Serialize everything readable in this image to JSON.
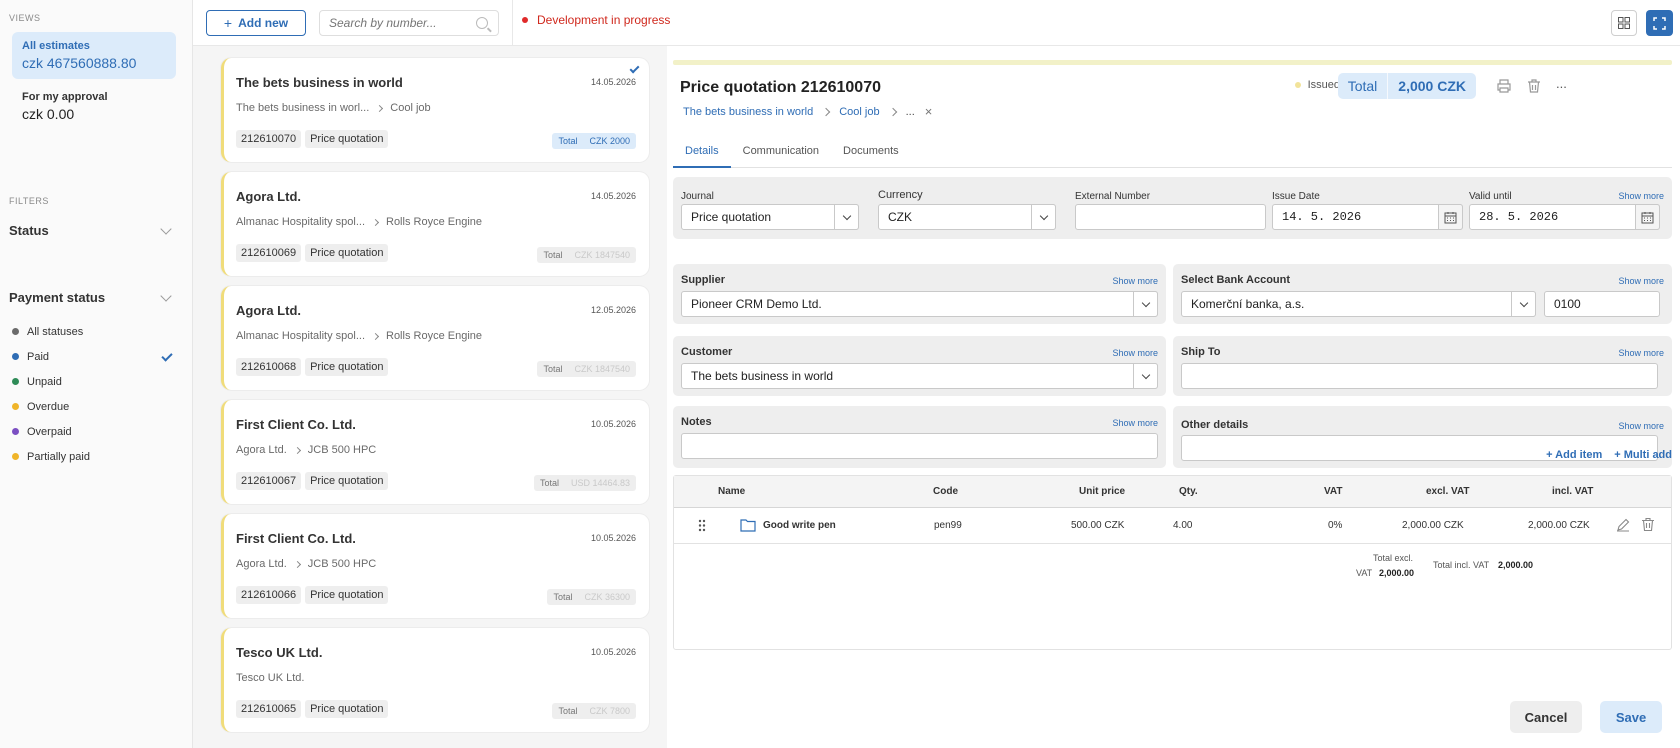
{
  "sidebar": {
    "views_title": "VIEWS",
    "views": [
      {
        "label": "All estimates",
        "amount": "czk 467560888.80"
      },
      {
        "label": "For my approval",
        "amount": "czk 0.00"
      }
    ],
    "filters_title": "FILTERS",
    "status_label": "Status",
    "payment_status_label": "Payment status",
    "statuses": [
      {
        "label": "All statuses",
        "color": "#6b6b6b"
      },
      {
        "label": "Paid",
        "color": "#2f6db5"
      },
      {
        "label": "Unpaid",
        "color": "#2e8b57"
      },
      {
        "label": "Overdue",
        "color": "#f0b429"
      },
      {
        "label": "Overpaid",
        "color": "#7b4fc2"
      },
      {
        "label": "Partially paid",
        "color": "#f0b429"
      }
    ]
  },
  "topbar": {
    "add_new": "Add new",
    "search_placeholder": "Search by number...",
    "dev_note": "Development in progress"
  },
  "cards": [
    {
      "title": "The bets business in world",
      "date": "14.05.2026",
      "path_a": "The bets business in worl...",
      "path_b": "Cool job",
      "number": "212610070",
      "type": "Price quotation",
      "total_label": "Total",
      "total": "CZK 2000"
    },
    {
      "title": "Agora Ltd.",
      "date": "14.05.2026",
      "path_a": "Almanac Hospitality spol...",
      "path_b": "Rolls Royce Engine",
      "number": "212610069",
      "type": "Price quotation",
      "total_label": "Total",
      "total": "CZK 1847540"
    },
    {
      "title": "Agora Ltd.",
      "date": "12.05.2026",
      "path_a": "Almanac Hospitality spol...",
      "path_b": "Rolls Royce Engine",
      "number": "212610068",
      "type": "Price quotation",
      "total_label": "Total",
      "total": "CZK 1847540"
    },
    {
      "title": "First Client Co. Ltd.",
      "date": "10.05.2026",
      "path_a": "Agora Ltd.",
      "path_b": "JCB 500 HPC",
      "number": "212610067",
      "type": "Price quotation",
      "total_label": "Total",
      "total": "USD 14464.83"
    },
    {
      "title": "First Client Co. Ltd.",
      "date": "10.05.2026",
      "path_a": "Agora Ltd.",
      "path_b": "JCB 500 HPC",
      "number": "212610066",
      "type": "Price quotation",
      "total_label": "Total",
      "total": "CZK 36300"
    },
    {
      "title": "Tesco UK Ltd.",
      "date": "10.05.2026",
      "path_a": "Tesco UK Ltd.",
      "path_b": "",
      "number": "212610065",
      "type": "Price quotation",
      "total_label": "Total",
      "total": "CZK 7800"
    }
  ],
  "detail": {
    "title": "Price quotation 212610070",
    "status": "Issued",
    "total_label": "Total",
    "total_value": "2,000 CZK",
    "more": "...",
    "crumbs": {
      "a": "The bets business in world",
      "b": "Cool job",
      "dots": "...",
      "close": "×"
    },
    "tabs": [
      "Details",
      "Communication",
      "Documents"
    ],
    "show_more": "Show more",
    "journal_label": "Journal",
    "journal_value": "Price quotation",
    "currency_label": "Currency",
    "currency_value": "CZK",
    "external_label": "External Number",
    "issue_label": "Issue Date",
    "issue_value": "14. 5. 2026",
    "valid_label": "Valid until",
    "valid_value": "28. 5. 2026",
    "supplier_label": "Supplier",
    "supplier_value": "Pioneer CRM Demo Ltd.",
    "bank_label": "Select Bank Account",
    "bank_value": "Komerční banka, a.s.",
    "bank_code": "0100",
    "customer_label": "Customer",
    "customer_value": "The bets business in world",
    "shipto_label": "Ship To",
    "notes_label": "Notes",
    "other_label": "Other details",
    "add_item": "+ Add item",
    "multi_add": "+ Multi add",
    "table_headers": {
      "name": "Name",
      "code": "Code",
      "unit_price": "Unit price",
      "qty": "Qty.",
      "vat": "VAT",
      "excl": "excl. VAT",
      "incl": "incl. VAT"
    },
    "row": {
      "name": "Good write pen",
      "code": "pen99",
      "unit_price": "500.00 CZK",
      "qty": "4.00",
      "vat": "0%",
      "excl": "2,000.00 CZK",
      "incl": "2,000.00 CZK"
    },
    "total_excl_label_1": "Total excl.",
    "total_excl_label_2": "VAT",
    "total_excl_value": "2,000.00",
    "total_incl_label": "Total incl. VAT",
    "total_incl_value": "2,000.00",
    "cancel": "Cancel",
    "save": "Save"
  }
}
